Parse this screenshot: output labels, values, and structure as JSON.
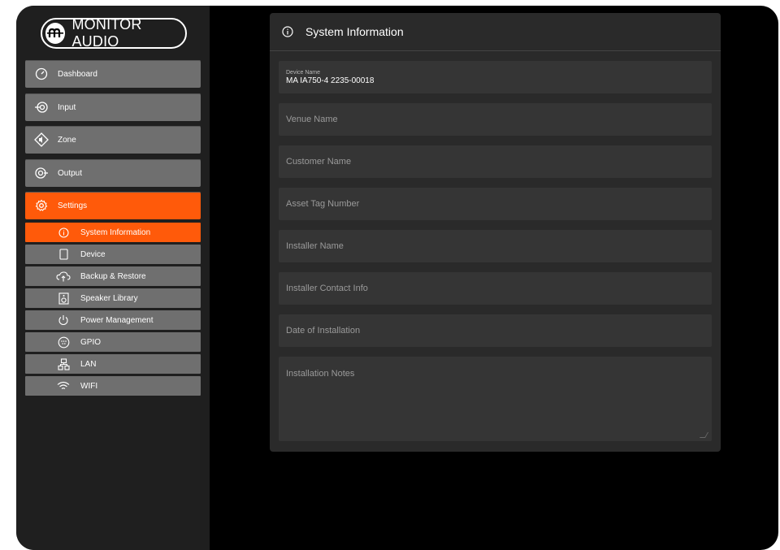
{
  "brand": {
    "logo_text": "MONITOR AUDIO"
  },
  "sidebar": {
    "items": [
      {
        "label": "Dashboard",
        "icon": "gauge-icon"
      },
      {
        "label": "Input",
        "icon": "input-icon"
      },
      {
        "label": "Zone",
        "icon": "zone-speaker-icon"
      },
      {
        "label": "Output",
        "icon": "output-icon"
      },
      {
        "label": "Settings",
        "icon": "gear-icon",
        "active": true
      }
    ],
    "settings_sub": [
      {
        "label": "System Information",
        "icon": "info-icon",
        "active": true
      },
      {
        "label": "Device",
        "icon": "device-icon"
      },
      {
        "label": "Backup & Restore",
        "icon": "cloud-upload-icon"
      },
      {
        "label": "Speaker Library",
        "icon": "speaker-icon"
      },
      {
        "label": "Power Management",
        "icon": "power-icon"
      },
      {
        "label": "GPIO",
        "icon": "gpio-icon"
      },
      {
        "label": "LAN",
        "icon": "lan-icon"
      },
      {
        "label": "WIFI",
        "icon": "wifi-icon"
      }
    ]
  },
  "panel": {
    "title": "System Information",
    "device_name": {
      "label": "Device Name",
      "value": "MA IA750-4 2235-00018"
    },
    "fields": [
      "Venue Name",
      "Customer Name",
      "Asset Tag Number",
      "Installer Name",
      "Installer Contact Info",
      "Date of Installation"
    ],
    "notes_placeholder": "Installation Notes"
  },
  "colors": {
    "accent": "#ff5a0a",
    "nav_bg": "#6f6f6f",
    "panel_bg": "#2a2a2a",
    "field_bg": "#353535"
  }
}
